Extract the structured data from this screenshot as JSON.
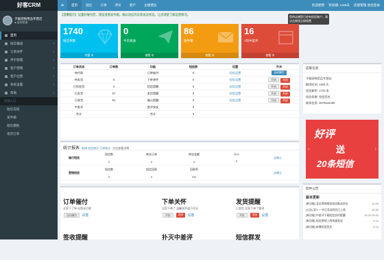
{
  "app": {
    "logo": "好客CRM"
  },
  "user": {
    "name": "子猴宠物用品专营店",
    "status": "● 店名状态"
  },
  "menu": [
    {
      "label": "首页",
      "active": true
    },
    {
      "label": "短信推送",
      "chev": "‹"
    },
    {
      "label": "订单关怀",
      "chev": "‹"
    },
    {
      "label": "评价管理",
      "chev": "‹"
    },
    {
      "label": "客户营销",
      "chev": "‹"
    },
    {
      "label": "客户出票",
      "chev": "‹"
    },
    {
      "label": "系统设置",
      "chev": "‹"
    },
    {
      "label": "帮助",
      "chev": "‹"
    }
  ],
  "quick": {
    "title": "快捷入口",
    "items": [
      "短信充值",
      "发件箱",
      "短信模板",
      "发货订单"
    ]
  },
  "topbar": {
    "menu": "≡",
    "items": [
      "首页",
      "短信",
      "订单",
      "评价",
      "客户",
      "主题建议"
    ],
    "right": [
      "欢迎使用",
      "有效期: 1189天",
      "店铺管理 退出登录"
    ]
  },
  "notice": "【温馨提示】设置好催付后，建议查看发件箱，确认短信的实际发送状态。让您清楚了解运营情况。",
  "tooltip": "您的店铺是已经有短信账户，请点击按钮立即续费",
  "boxes": [
    {
      "num": "1740",
      "label": "短信余额",
      "foot": "充值 ⊕",
      "color": "#00c0ef"
    },
    {
      "num": "0",
      "label": "今日发送",
      "foot": "查看 ⊕",
      "color": "#00a65a"
    },
    {
      "num": "86",
      "label": "收件箱",
      "foot": "查看 ⊕",
      "color": "#f39c12"
    },
    {
      "num": "16",
      "label": "7日中差评",
      "foot": "查看 ⊕",
      "color": "#dd4b39"
    }
  ],
  "table": {
    "headers": [
      "订单状态",
      "订单数",
      "功能",
      "短信数",
      "设置",
      "开关"
    ],
    "rows": [
      {
        "status": "待付款",
        "orders": "",
        "func": "订单催付",
        "sms": "0",
        "set": "短信设置",
        "switch": "onblue",
        "switch_label": "自动催付"
      },
      {
        "status": "待发货",
        "orders": "0",
        "func": "下单关怀",
        "sms": "0",
        "set": "短信设置",
        "switch": "pair"
      },
      {
        "status": "已到发货",
        "orders": "3",
        "func": "短信提醒",
        "sms": "0",
        "set": "短信设置",
        "switch": "pair"
      },
      {
        "status": "已发货",
        "orders": "57",
        "func": "发货提醒",
        "sms": "0",
        "set": "短信设置",
        "switch": "pair"
      },
      {
        "status": "已收货",
        "orders": "61",
        "func": "确认提醒",
        "sms": "0",
        "set": "短信设置",
        "switch": "pair"
      },
      {
        "status": "中差评",
        "orders": "",
        "func": "差评安抚",
        "sms": "0",
        "set": "",
        "switch": ""
      },
      {
        "status": "合计",
        "orders": "",
        "func": "合计",
        "sms": "0",
        "set": "",
        "switch": ""
      }
    ],
    "on_label": "开启",
    "off_label": "关闭"
  },
  "store": {
    "title": "店家信息",
    "lines": [
      "子猴宠物用品专营店",
      "剩余时间: 1189 天",
      "短信剩余: 1740 条",
      "短信条数: 短信签名",
      "联系信息: 2575544480"
    ]
  },
  "stats": {
    "title": "统计报表",
    "sub": "新增 短信统计 订单统计",
    "more": "点击查看详情",
    "rows": [
      {
        "label": "催付短信",
        "cols": [
          [
            "短信数",
            "0"
          ],
          [
            "转化订单",
            "0"
          ],
          [
            "转化金额",
            "0"
          ],
          [
            "ROI",
            "0"
          ]
        ],
        "link": "去确认"
      },
      {
        "label": "营销短信",
        "cols": [
          [
            "短信数",
            "0"
          ],
          [
            "短信回款",
            "0"
          ],
          [
            "回款率",
            "0%"
          ],
          [
            "",
            ""
          ]
        ],
        "link": "去确认"
      }
    ]
  },
  "cards": [
    {
      "title": "订单催付",
      "desc": "买家下了单 但是未付款",
      "ctl": [
        "自动催付",
        "设置"
      ]
    },
    {
      "title": "下单关怀",
      "desc": "买家下单了 温馨关怀留下印记",
      "ctl": [
        "开启",
        "关闭",
        "设置"
      ]
    },
    {
      "title": "发货提醒",
      "desc": "已发货 买家下单了物流",
      "ctl": [
        "开启",
        "关闭",
        "设置"
      ]
    },
    {
      "title": "签收提醒",
      "desc": "",
      "ctl": []
    },
    {
      "title": "扑灭中差评",
      "desc": "",
      "ctl": []
    },
    {
      "title": "短信群发",
      "desc": "",
      "ctl": []
    }
  ],
  "banner": {
    "t1": "好评",
    "t2": "送",
    "t3": "20条短信"
  },
  "log": {
    "title": "软件公告",
    "subtitle": "版本更新",
    "entries": [
      {
        "text": "[新功能] 会员营销两段短信推送优化",
        "time": "11-04"
      },
      {
        "text": "[公告] 双十一节日活动短信已上线",
        "time": "10-30"
      },
      {
        "text": "[新功能] 中差评下载短信实时提醒",
        "time": "10-21 01:22"
      },
      {
        "text": "[新功能] 短信营销上线快速发送",
        "time": "9-14"
      },
      {
        "text": "[新功能] 新增短信签名",
        "time": "9-14"
      }
    ]
  }
}
